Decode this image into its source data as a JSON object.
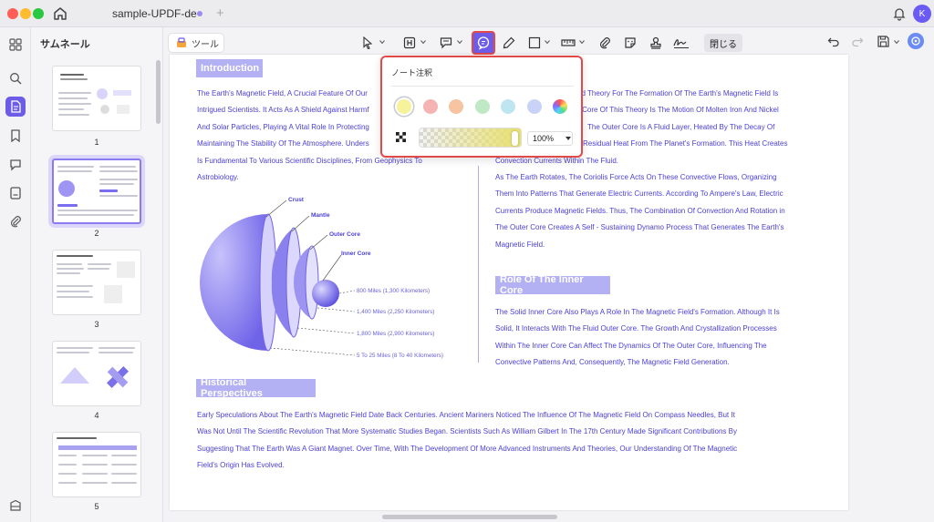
{
  "window": {
    "tab_title": "sample-UPDF-de",
    "avatar_letter": "K"
  },
  "sidebar": {
    "title": "サムネール",
    "pages": [
      "1",
      "2",
      "3",
      "4",
      "5"
    ],
    "selected_page": "2"
  },
  "toolbar": {
    "tools_label": "ツール",
    "close_label": "閉じる",
    "accent": "#6c5ce7",
    "highlight": "#e24a4a"
  },
  "popup": {
    "title": "ノート注釈",
    "colors": [
      "#f7f39a",
      "#f5b3b3",
      "#f6c4a0",
      "#bfe8c4",
      "#bfe5f2",
      "#c9d2f7",
      "rainbow"
    ],
    "selected_color": "#f7f39a",
    "opacity": "100%",
    "opacity_value": 1.0
  },
  "document": {
    "headings": {
      "introduction": "Introduction",
      "inner_core": "Role Of The Inner Core",
      "historical": "Historical Perspectives"
    },
    "left_col": [
      "The Earth's Magnetic Field, A Crucial Feature Of Our",
      "Intrigued Scientists. It Acts As A Shield Against Harmf",
      "And Solar Particles, Playing A Vital Role In Protecting",
      "Maintaining The Stability Of The Atmosphere. Unders",
      "Is Fundamental To Various Scientific Disciplines, From Geophysics To",
      "Astrobiology."
    ],
    "right_col": [
      "ed Theory For The Formation Of The Earth's Magnetic Field Is",
      "he Core Of This Theory Is The Motion Of Molten Iron And Nickel",
      "The Outer Core Is A Fluid Layer, Heated By The Decay Of",
      "Residual Heat From The Planet's Formation. This Heat Creates",
      "Convection Currents Within The Fluid.",
      "As The Earth Rotates, The Coriolis Force Acts On These Convective Flows, Organizing",
      "Them Into Patterns That Generate Electric Currents. According To Ampere's Law, Electric",
      "Currents Produce Magnetic Fields. Thus, The Combination Of Convection And Rotation in",
      "The Outer Core Creates A Self - Sustaining Dynamo Process That Generates The Earth's",
      "Magnetic Field."
    ],
    "inner_core_text": [
      "The Solid Inner Core Also Plays A Role In The Magnetic Field's Formation. Although It Is",
      "Solid, It Interacts With The Fluid Outer Core. The Growth And Crystallization Processes",
      "Within The Inner Core Can Affect The Dynamics Of The Outer Core, Influencing The",
      "Convective Patterns And, Consequently, The Magnetic Field Generation."
    ],
    "historical_text": [
      "Early Speculations About The Earth's Magnetic Field Date Back Centuries. Ancient Mariners Noticed The Influence Of The Magnetic Field On Compass Needles, But It",
      "Was Not Until The Scientific Revolution That More Systematic Studies Began. Scientists Such As William Gilbert In The 17th Century Made Significant Contributions By",
      "Suggesting That The Earth Was A Giant Magnet. Over Time, With The Development Of More Advanced Instruments And Theories, Our Understanding Of The Magnetic",
      "Field's Origin Has Evolved."
    ],
    "diagram": {
      "labels": [
        "Crust",
        "Mantle",
        "Outer Core",
        "Inner Core"
      ],
      "measures": [
        "800 Miles (1,300 Kilometers)",
        "1,400 Miles (2,250 Kilometers)",
        "1,800 Miles (2,900 Kilometers)",
        "5 To 25 Miles (8 To 40 Kilometers)"
      ]
    }
  }
}
